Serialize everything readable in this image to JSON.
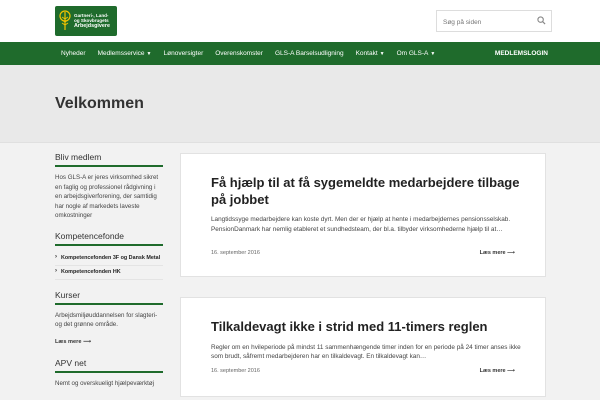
{
  "brand": {
    "line1": "Gartneri-, Land-",
    "line2": "og Skovbrugets",
    "line3": "Arbejdsgivere",
    "color": "#1f6b2c"
  },
  "search": {
    "placeholder": "Søg på siden",
    "icon": "search-icon"
  },
  "nav": {
    "items": [
      {
        "label": "Nyheder",
        "dropdown": false
      },
      {
        "label": "Medlemsservice",
        "dropdown": true
      },
      {
        "label": "Lønoversigter",
        "dropdown": false
      },
      {
        "label": "Overenskomster",
        "dropdown": false
      },
      {
        "label": "GLS-A Barselsudligning",
        "dropdown": false
      },
      {
        "label": "Kontakt",
        "dropdown": true
      },
      {
        "label": "Om GLS-A",
        "dropdown": true
      }
    ],
    "login": "MEDLEMSLOGIN"
  },
  "page": {
    "title": "Velkommen"
  },
  "sidebar": {
    "bliv": {
      "heading": "Bliv medlem",
      "text": "Hos GLS-A er jeres virksomhed sikret en faglig og professionel rådgivning i en arbejdsgiverforening, der samtidig har nogle af markedets laveste omkostninger"
    },
    "kompetence": {
      "heading": "Kompetencefonde",
      "items": [
        "Kompetencefonden 3F og Dansk Metal",
        "Kompetencefonden HK"
      ]
    },
    "kurser": {
      "heading": "Kurser",
      "text": "Arbejdsmiljøuddannelsen for slagteri- og det grønne område.",
      "more": "Læs mere ⟶"
    },
    "apv": {
      "heading": "APV net",
      "text": "Nemt og overskueligt hjælpeværktøj"
    }
  },
  "posts": [
    {
      "title": "Få hjælp til at få sygemeldte medarbejdere tilbage på jobbet",
      "excerpt": "Langtidssyge medarbejdere kan koste dyrt. Men der er hjælp at hente i medarbejdernes pensionsselskab. PensionDanmark har nemlig etableret et sundhedsteam, der bl.a. tilbyder virksomhederne hjælp til at…",
      "date": "16. september 2016",
      "more": "Læs mere ⟶"
    },
    {
      "title": "Tilkaldevagt ikke i strid med 11-timers reglen",
      "excerpt": "Regler om en hvileperiode på mindst 11 sammenhængende timer inden for en periode på 24 timer anses ikke som brudt, såfremt medarbejderen har en tilkaldevagt. En tilkaldevagt kan…",
      "date": "16. september 2016",
      "more": "Læs mere ⟶"
    }
  ]
}
